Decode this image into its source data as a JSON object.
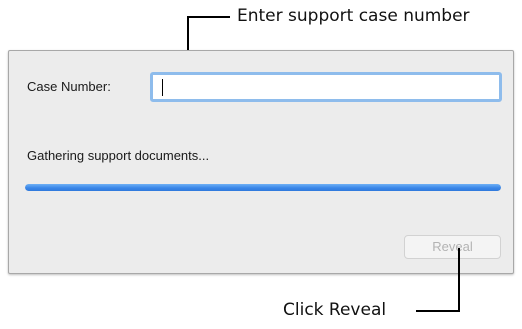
{
  "annotations": {
    "top_callout": "Enter support case number",
    "bottom_callout": "Click Reveal"
  },
  "dialog": {
    "case_number_label": "Case Number:",
    "case_number_value": "",
    "status_text": "Gathering support documents...",
    "progress": {
      "fraction": 1.0
    },
    "reveal_button_label": "Reveal",
    "reveal_button_enabled": false
  },
  "colors": {
    "progress_fill": "#3b87e8",
    "input_focus_ring": "#8ebcec",
    "dialog_background": "#ececec",
    "disabled_button_text": "#b3b3b3"
  }
}
